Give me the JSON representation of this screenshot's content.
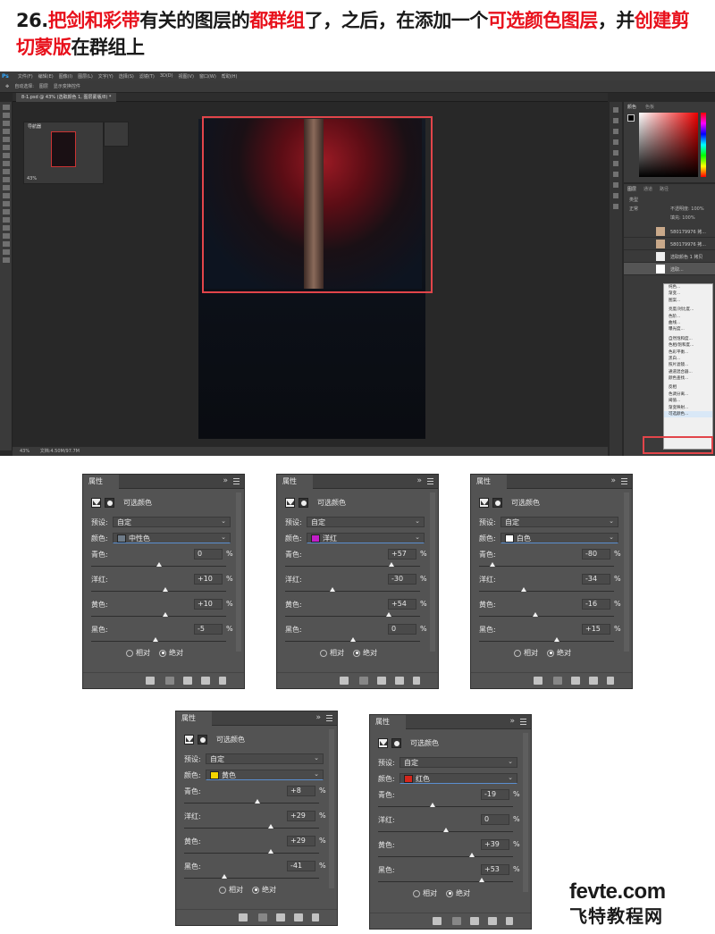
{
  "title": {
    "part1": "26.",
    "part2": "把剑和彩带",
    "part3": "有关的图层的",
    "part4": "都群组",
    "part5": "了，之后，在添加一个",
    "part6": "可选颜色图层",
    "part7": "，并",
    "part8": "创建剪切蒙版",
    "part9": "在群组上"
  },
  "photoshop": {
    "logo": "Ps",
    "menu": [
      "文件(F)",
      "编辑(E)",
      "图像(I)",
      "图层(L)",
      "文字(Y)",
      "选择(S)",
      "滤镜(T)",
      "3D(D)",
      "视图(V)",
      "窗口(W)",
      "帮助(H)"
    ],
    "options": [
      "自动选择:",
      "图层",
      "显示变换控件"
    ],
    "doc_tab": "8-1.psd @ 43% (选取颜色 1, 图层蒙版/8) *",
    "navigator_tab": "导航器",
    "navigator_zoom": "43%",
    "status": "文档:4.50M/97.7M",
    "status_zoom": "43%",
    "color_tab": "颜色",
    "swatch_tab": "色板",
    "layers_tabs": [
      "图层",
      "通道",
      "路径"
    ],
    "layers_kind": "类型",
    "layers_mode": "正常",
    "layers_opacity": "不透明度: 100%",
    "layers_fill": "填充: 100%",
    "layers": [
      "580179976 拷...",
      "580179976 拷...",
      "选取颜色 1 拷贝",
      "选取..."
    ],
    "context_menu": [
      "纯色...",
      "渐变...",
      "图案...",
      "",
      "亮度/对比度...",
      "色阶...",
      "曲线...",
      "曝光度...",
      "",
      "自然饱和度...",
      "色相/饱和度...",
      "色彩平衡...",
      "黑白...",
      "照片滤镜...",
      "通道混合器...",
      "颜色查找...",
      "",
      "反相",
      "色调分离...",
      "阈值...",
      "渐变映射...",
      "可选颜色..."
    ]
  },
  "panels": [
    {
      "tab": "属性",
      "header": "可选颜色",
      "preset_label": "预设:",
      "preset": "自定",
      "color_label": "颜色:",
      "color": "中性色",
      "swatch": "#6e7b88",
      "sliders": [
        {
          "label": "青色:",
          "value": "0",
          "pct": 0
        },
        {
          "label": "洋红:",
          "value": "+10",
          "pct": 10
        },
        {
          "label": "黄色:",
          "value": "+10",
          "pct": 10
        },
        {
          "label": "黑色:",
          "value": "-5",
          "pct": -5
        }
      ],
      "relative": "相对",
      "absolute": "绝对"
    },
    {
      "tab": "属性",
      "header": "可选颜色",
      "preset_label": "预设:",
      "preset": "自定",
      "color_label": "颜色:",
      "color": "洋红",
      "swatch": "#c21ec7",
      "sliders": [
        {
          "label": "青色:",
          "value": "+57",
          "pct": 57
        },
        {
          "label": "洋红:",
          "value": "-30",
          "pct": -30
        },
        {
          "label": "黄色:",
          "value": "+54",
          "pct": 54
        },
        {
          "label": "黑色:",
          "value": "0",
          "pct": 0
        }
      ],
      "relative": "相对",
      "absolute": "绝对"
    },
    {
      "tab": "属性",
      "header": "可选颜色",
      "preset_label": "预设:",
      "preset": "自定",
      "color_label": "颜色:",
      "color": "白色",
      "swatch": "#ffffff",
      "sliders": [
        {
          "label": "青色:",
          "value": "-80",
          "pct": -80
        },
        {
          "label": "洋红:",
          "value": "-34",
          "pct": -34
        },
        {
          "label": "黄色:",
          "value": "-16",
          "pct": -16
        },
        {
          "label": "黑色:",
          "value": "+15",
          "pct": 15
        }
      ],
      "relative": "相对",
      "absolute": "绝对"
    },
    {
      "tab": "属性",
      "header": "可选颜色",
      "preset_label": "预设:",
      "preset": "自定",
      "color_label": "颜色:",
      "color": "黄色",
      "swatch": "#f4d500",
      "sliders": [
        {
          "label": "青色:",
          "value": "+8",
          "pct": 8
        },
        {
          "label": "洋红:",
          "value": "+29",
          "pct": 29
        },
        {
          "label": "黄色:",
          "value": "+29",
          "pct": 29
        },
        {
          "label": "黑色:",
          "value": "-41",
          "pct": -41
        }
      ],
      "relative": "相对",
      "absolute": "绝对"
    },
    {
      "tab": "属性",
      "header": "可选颜色",
      "preset_label": "预设:",
      "preset": "自定",
      "color_label": "颜色:",
      "color": "红色",
      "swatch": "#d4261b",
      "sliders": [
        {
          "label": "青色:",
          "value": "-19",
          "pct": -19
        },
        {
          "label": "洋红:",
          "value": "0",
          "pct": 0
        },
        {
          "label": "黄色:",
          "value": "+39",
          "pct": 39
        },
        {
          "label": "黑色:",
          "value": "+53",
          "pct": 53
        }
      ],
      "relative": "相对",
      "absolute": "绝对"
    }
  ],
  "watermark": {
    "line1": "fevte.com",
    "line2": "飞特教程网"
  },
  "colors": {
    "highlight": "#e8111c",
    "box": "#e2454a"
  }
}
